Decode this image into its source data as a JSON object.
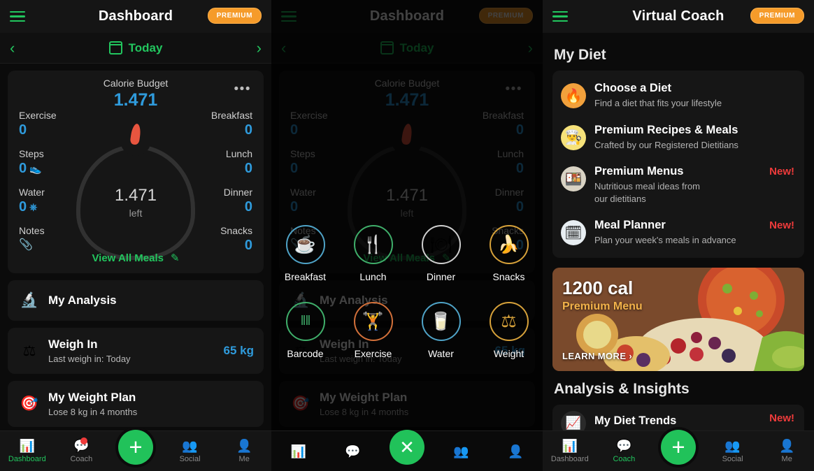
{
  "colors": {
    "green": "#22c55e",
    "blue": "#2f9bdc",
    "orange": "#f59b2a",
    "red": "#ef3b3b",
    "card": "#161616"
  },
  "panel1": {
    "topbar": {
      "title": "Dashboard",
      "premium": "PREMIUM",
      "menu_icon": "hamburger-icon"
    },
    "datebar": {
      "label": "Today",
      "prev": "‹",
      "next": "›"
    },
    "calorie_card": {
      "title": "Calorie Budget",
      "value": "1.471",
      "more": "•••",
      "ring_value": "1.471",
      "ring_label": "left",
      "left_stats": [
        {
          "label": "Exercise",
          "value": "0"
        },
        {
          "label": "Steps",
          "value": "0",
          "icon": "shoe-icon"
        },
        {
          "label": "Water",
          "value": "0",
          "icon": "glass-icon"
        },
        {
          "label": "Notes",
          "value": "",
          "icon": "paperclip-icon"
        }
      ],
      "right_stats": [
        {
          "label": "Breakfast",
          "value": "0"
        },
        {
          "label": "Lunch",
          "value": "0"
        },
        {
          "label": "Dinner",
          "value": "0"
        },
        {
          "label": "Snacks",
          "value": "0"
        }
      ],
      "view_all": "View All Meals",
      "edit_icon": "pencil-icon"
    },
    "rows": [
      {
        "icon": "microscope-icon",
        "glyph": "🔬",
        "title": "My Analysis",
        "sub": "",
        "right": ""
      },
      {
        "icon": "scale-icon",
        "glyph": "⚖",
        "title": "Weigh In",
        "sub": "Last weigh in: Today",
        "right": "65 kg"
      },
      {
        "icon": "target-icon",
        "glyph": "🎯",
        "title": "My Weight Plan",
        "sub": "Lose 8 kg in 4 months",
        "right": ""
      }
    ],
    "nav": [
      {
        "label": "Dashboard",
        "icon": "chart-icon",
        "glyph": "📊",
        "active": true,
        "badge": false
      },
      {
        "label": "Coach",
        "icon": "coach-icon",
        "glyph": "💬",
        "active": false,
        "badge": true
      },
      {
        "label": "",
        "icon": "add-icon",
        "glyph": "+",
        "active": false,
        "badge": false
      },
      {
        "label": "Social",
        "icon": "social-icon",
        "glyph": "👥",
        "active": false,
        "badge": false
      },
      {
        "label": "Me",
        "icon": "profile-icon",
        "glyph": "👤",
        "active": false,
        "badge": false
      }
    ]
  },
  "panel2": {
    "quick_add": [
      {
        "label": "Breakfast",
        "icon": "coffee-cup-icon",
        "glyph": "☕",
        "color": "#4fa3c7"
      },
      {
        "label": "Lunch",
        "icon": "cutlery-icon",
        "glyph": "🍴",
        "color": "#3fae6a"
      },
      {
        "label": "Dinner",
        "icon": "cloche-icon",
        "glyph": "🍽",
        "color": "#cfcfcf"
      },
      {
        "label": "Snacks",
        "icon": "banana-icon",
        "glyph": "🍌",
        "color": "#d6a13a"
      },
      {
        "label": "Barcode",
        "icon": "barcode-icon",
        "glyph": "‖‖",
        "color": "#3fae6a"
      },
      {
        "label": "Exercise",
        "icon": "dumbbell-icon",
        "glyph": "🏋",
        "color": "#d2703a"
      },
      {
        "label": "Water",
        "icon": "water-glass-icon",
        "glyph": "🥛",
        "color": "#4fa3c7"
      },
      {
        "label": "Weight",
        "icon": "weight-scale-icon",
        "glyph": "⚖",
        "color": "#d6a13a"
      }
    ],
    "close": "✕"
  },
  "panel3": {
    "topbar": {
      "title": "Virtual Coach",
      "premium": "PREMIUM",
      "menu_icon": "hamburger-icon"
    },
    "section1": "My Diet",
    "diet_items": [
      {
        "title": "Choose a Diet",
        "sub": "Find a diet that fits your lifestyle",
        "icon": "flame-icon",
        "glyph": "🔥",
        "bg": "#f2a13c",
        "tag": ""
      },
      {
        "title": "Premium Recipes & Meals",
        "sub": "Crafted by our Registered Dietitians",
        "icon": "chef-hat-icon",
        "glyph": "👨‍🍳",
        "bg": "#f6e27a",
        "tag": ""
      },
      {
        "title": "Premium Menus",
        "sub": "Nutritious meal ideas from\nour dietitians",
        "icon": "menu-tray-icon",
        "glyph": "🍱",
        "bg": "#d9d3c4",
        "tag": "New!"
      },
      {
        "title": "Meal Planner",
        "sub": "Plan your week's meals in advance",
        "icon": "calendar-clock-icon",
        "glyph": "🗓",
        "bg": "#e8eef2",
        "tag": "New!"
      }
    ],
    "promo": {
      "cal": "1200 cal",
      "sub": "Premium Menu",
      "cta": "LEARN MORE ›"
    },
    "section2": "Analysis & Insights",
    "trend": {
      "title": "My Diet Trends",
      "tag": "New!",
      "icon": "trend-chart-icon",
      "glyph": "📈"
    },
    "nav": [
      {
        "label": "Dashboard",
        "icon": "chart-icon",
        "glyph": "📊",
        "active": false
      },
      {
        "label": "Coach",
        "icon": "coach-icon",
        "glyph": "💬",
        "active": true
      },
      {
        "label": "",
        "icon": "add-icon",
        "glyph": "+",
        "active": false
      },
      {
        "label": "Social",
        "icon": "social-icon",
        "glyph": "👥",
        "active": false
      },
      {
        "label": "Me",
        "icon": "profile-icon",
        "glyph": "👤",
        "active": false
      }
    ]
  }
}
